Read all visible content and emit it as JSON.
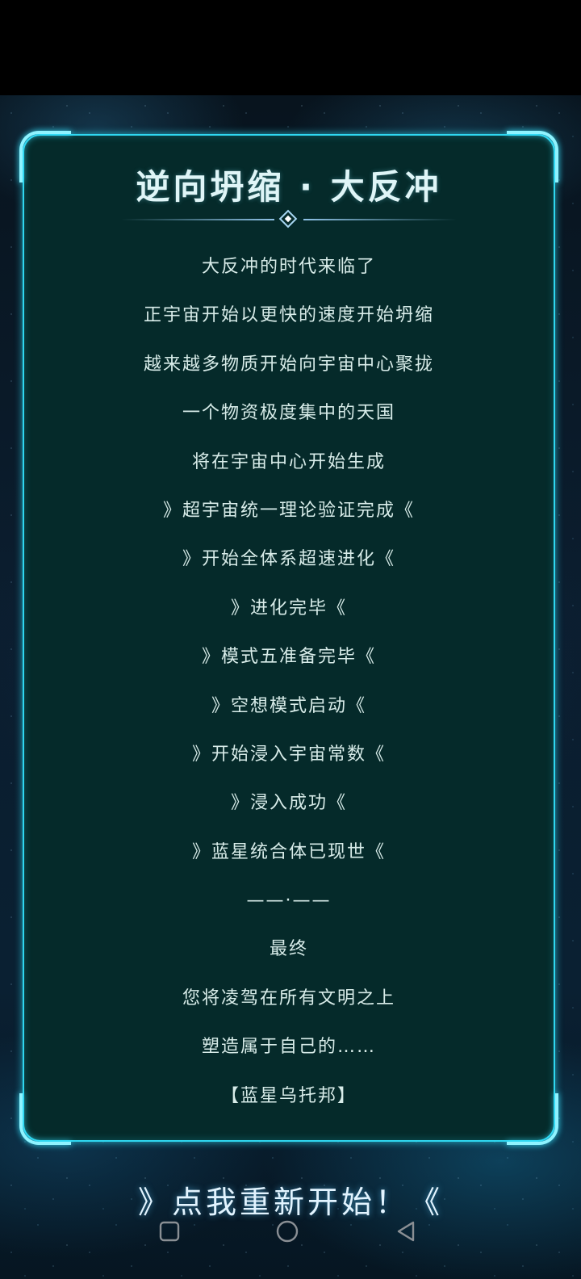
{
  "panel": {
    "title": "逆向坍缩 · 大反冲",
    "lines": [
      "大反冲的时代来临了",
      "正宇宙开始以更快的速度开始坍缩",
      "越来越多物质开始向宇宙中心聚拢",
      "一个物资极度集中的天国",
      "将在宇宙中心开始生成",
      "》超宇宙统一理论验证完成《",
      "》开始全体系超速进化《",
      "》进化完毕《",
      "》模式五准备完毕《",
      "》空想模式启动《",
      "》开始浸入宇宙常数《",
      "》浸入成功《",
      "》蓝星统合体已现世《",
      "——·——",
      "最终",
      "您将凌驾在所有文明之上",
      "塑造属于自己的……",
      "【蓝星乌托邦】"
    ]
  },
  "restart_button": {
    "label": "》点我重新开始！《"
  },
  "nav_bar": {
    "recents_icon": "square-recents-icon",
    "home_icon": "circle-home-icon",
    "back_icon": "triangle-back-icon"
  },
  "colors": {
    "panel_fill": "#052a2a",
    "panel_border": "#2fd7f0",
    "text": "#d8ece9"
  }
}
